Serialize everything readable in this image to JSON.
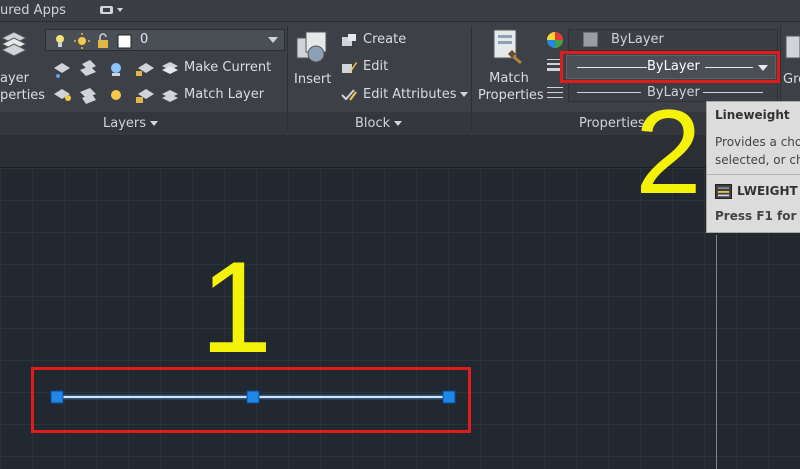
{
  "tabs": {
    "featured_apps": "ured Apps"
  },
  "layers_panel": {
    "layer_properties_line1": "ayer",
    "layer_properties_line2": "perties",
    "layer_combo_value": "0",
    "make_current": "Make Current",
    "match_layer": "Match Layer",
    "title": "Layers"
  },
  "block_panel": {
    "insert": "Insert",
    "create": "Create",
    "edit": "Edit",
    "edit_attributes": "Edit Attributes",
    "title": "Block"
  },
  "properties_panel": {
    "match_properties_line1": "Match",
    "match_properties_line2": "Properties",
    "color_value": "ByLayer",
    "lineweight_value": "ByLayer",
    "linetype_value": "ByLayer",
    "title": "Properties"
  },
  "groups_panel": {
    "label_partial": "Gro"
  },
  "tooltip": {
    "title": "Lineweight",
    "desc_line1": "Provides a cho",
    "desc_line2": "selected, or ch",
    "command": "LWEIGHT",
    "help": "Press F1 for m"
  },
  "annotations": {
    "step1": "1",
    "step2": "2"
  },
  "colors": {
    "ribbon_bg": "#3d4147",
    "canvas_bg": "#212830",
    "grip_blue": "#1e88e5",
    "annotation_yellow": "#f5f20a",
    "highlight_red": "#e01b1b"
  }
}
